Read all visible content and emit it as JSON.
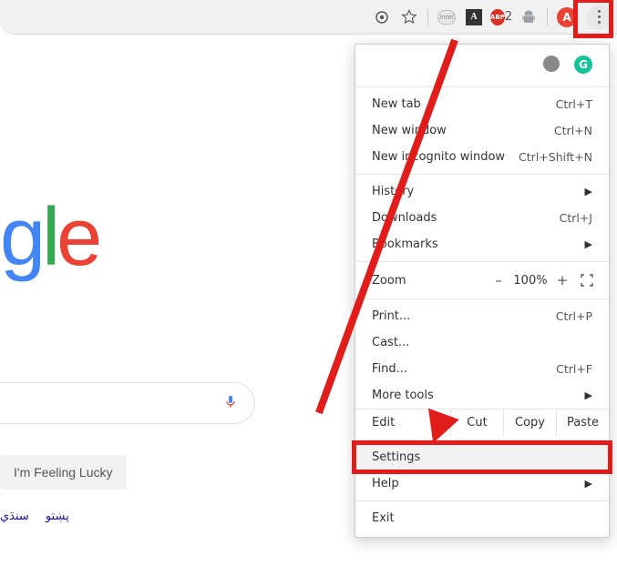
{
  "toolbar": {
    "abp_badge": "2",
    "avatar_initial": "A"
  },
  "page": {
    "logo_fragment": "gle",
    "lucky_button": "I'm Feeling Lucky",
    "languages": [
      "پښتو",
      "سنڌي"
    ]
  },
  "ext": {
    "grammarly_initial": "G"
  },
  "menu": {
    "new_tab": {
      "label": "New tab",
      "shortcut": "Ctrl+T"
    },
    "new_window": {
      "label": "New window",
      "shortcut": "Ctrl+N"
    },
    "incognito": {
      "label": "New incognito window",
      "shortcut": "Ctrl+Shift+N"
    },
    "history": {
      "label": "History"
    },
    "downloads": {
      "label": "Downloads",
      "shortcut": "Ctrl+J"
    },
    "bookmarks": {
      "label": "Bookmarks"
    },
    "zoom": {
      "label": "Zoom",
      "value": "100%",
      "minus": "–",
      "plus": "+"
    },
    "print": {
      "label": "Print...",
      "shortcut": "Ctrl+P"
    },
    "cast": {
      "label": "Cast..."
    },
    "find": {
      "label": "Find...",
      "shortcut": "Ctrl+F"
    },
    "more_tools": {
      "label": "More tools"
    },
    "edit": {
      "label": "Edit",
      "cut": "Cut",
      "copy": "Copy",
      "paste": "Paste"
    },
    "settings": {
      "label": "Settings"
    },
    "help": {
      "label": "Help"
    },
    "exit": {
      "label": "Exit"
    }
  }
}
